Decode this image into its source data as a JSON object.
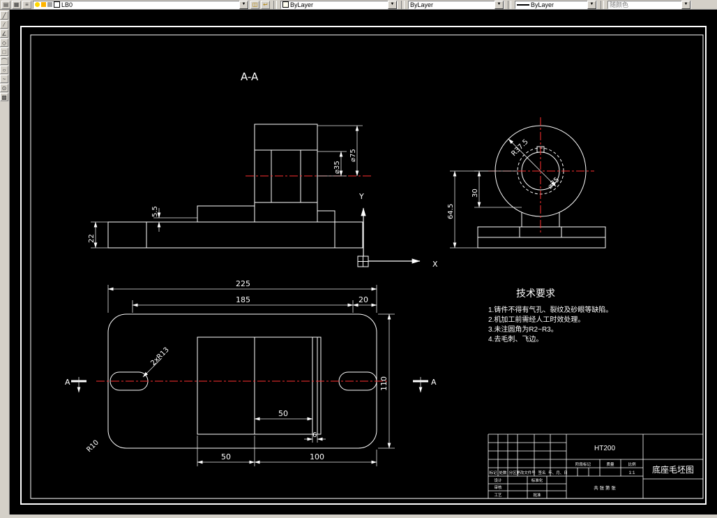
{
  "toolbar": {
    "layer": {
      "value": "LB0"
    },
    "color": {
      "value": "ByLayer"
    },
    "linetype": {
      "value": "ByLayer"
    },
    "lineweight": {
      "value": "ByLayer"
    },
    "plotstyle": {
      "value": "随颜色"
    }
  },
  "drawing": {
    "section_label": "A-A",
    "axes": {
      "x": "X",
      "y": "Y"
    },
    "dims": {
      "bore_dia": "⌀35",
      "boss_dia": "⌀75",
      "step_h": "5.5",
      "base_h": "22",
      "center_h": "30",
      "total_h": "64.5",
      "boss_r": "R37.5",
      "end_bore": "⌀35",
      "len_total": "225",
      "len_inner": "185",
      "len_end": "20",
      "width": "110",
      "bot_left": "50",
      "bot_right": "100",
      "mid": "50",
      "strip": "6",
      "slot_r": "2xR13",
      "corner_r": "R10",
      "sec_a_left": "A",
      "sec_a_right": "A"
    },
    "tech": {
      "title": "技术要求",
      "notes": [
        "1.铸件不得有气孔、裂纹及砂眼等缺陷。",
        "2.机加工前需经人工时效处理。",
        "3.未注圆角为R2~R3。",
        "4.去毛刺、飞边。"
      ]
    }
  },
  "title_block": {
    "material": "HT200",
    "drawing_title": "底座毛坯图",
    "rev_headers": [
      "标记",
      "处数",
      "分区",
      "更改文件号",
      "签名",
      "年、月、日"
    ],
    "sign_rows": [
      "设计",
      "审核",
      "工艺"
    ],
    "sign_rows_right": [
      "标准化",
      "批准"
    ],
    "stage_label": "阶段标记",
    "weight_label": "质量",
    "scale_label": "比例",
    "scale_value": "1:1",
    "sheet_info": "共 张 第 张"
  },
  "colors": {
    "canvas_bg": "#000000",
    "line": "#ffffff",
    "centerline": "#ff3030",
    "slot_hatch": "#7fc08a",
    "ui_bg": "#d4d0c8"
  }
}
